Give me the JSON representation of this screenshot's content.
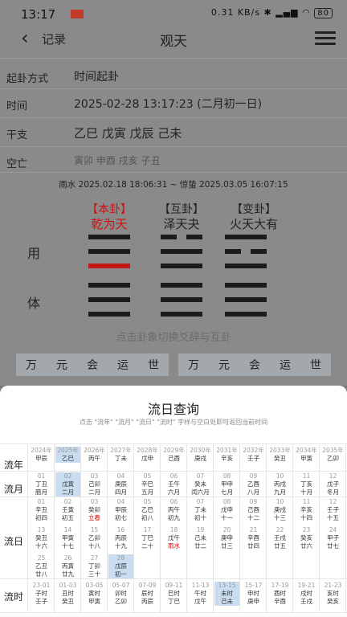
{
  "status": {
    "time": "13:17",
    "net": "0.31 KB/s",
    "battery": "80"
  },
  "nav": {
    "back_label": "记录",
    "title": "观天"
  },
  "info": [
    {
      "key": "起卦方式",
      "value": "时间起卦"
    },
    {
      "key": "时间",
      "value": "2025-02-28 13:17:23 (二月初一日)"
    },
    {
      "key": "干支",
      "value": "乙巳 戊寅 戊辰 己未"
    },
    {
      "key": "空亡",
      "value": "寅卯 申酉 戌亥 子丑"
    }
  ],
  "jieqi": "雨水 2025.02.18 18:06:31 ~ 惊蛰 2025.03.05 16:07:15",
  "gua": [
    {
      "head": "【本卦】",
      "name": "乾为天"
    },
    {
      "head": "【互卦】",
      "name": "泽天夬"
    },
    {
      "head": "【变卦】",
      "name": "火天大有"
    }
  ],
  "yong": "用",
  "ti": "体",
  "hint": "点击卦象切换爻辞与互卦",
  "tabs_left": [
    "万",
    "元",
    "会",
    "运",
    "世"
  ],
  "tabs_right": [
    "万",
    "元",
    "会",
    "运",
    "世"
  ],
  "sheet": {
    "title": "流日查询",
    "subtitle": "点击 \"流年\" \"流月\" \"流日\" \"流时\" 字样与空白处即可返回当前时间",
    "row_labels": [
      "流年",
      "流月",
      "流日",
      "流时"
    ],
    "years": [
      [
        "2024年",
        "甲辰"
      ],
      [
        "2025年",
        "乙巳"
      ],
      [
        "2026年",
        "丙午"
      ],
      [
        "2027年",
        "丁未"
      ],
      [
        "2028年",
        "戊申"
      ],
      [
        "2029年",
        "己酉"
      ],
      [
        "2030年",
        "庚戌"
      ],
      [
        "2031年",
        "辛亥"
      ],
      [
        "2032年",
        "壬子"
      ],
      [
        "2033年",
        "癸丑"
      ],
      [
        "2034年",
        "甲寅"
      ],
      [
        "2035年",
        "乙卯"
      ]
    ],
    "months": [
      [
        "01",
        "丁丑",
        "腊月"
      ],
      [
        "02",
        "戊寅",
        "二月"
      ],
      [
        "03",
        "己卯",
        "二月"
      ],
      [
        "04",
        "庚辰",
        "四月"
      ],
      [
        "05",
        "辛巳",
        "五月"
      ],
      [
        "06",
        "壬午",
        "六月"
      ],
      [
        "07",
        "癸未",
        "闰六月"
      ],
      [
        "08",
        "甲申",
        "七月"
      ],
      [
        "09",
        "乙酉",
        "八月"
      ],
      [
        "10",
        "丙戌",
        "九月"
      ],
      [
        "11",
        "丁亥",
        "十月"
      ],
      [
        "12",
        "戊子",
        "冬月"
      ]
    ],
    "days": [
      [
        "01",
        "辛丑",
        "初四"
      ],
      [
        "02",
        "壬寅",
        "初五"
      ],
      [
        "03",
        "癸卯",
        "立春"
      ],
      [
        "04",
        "甲辰",
        "初七"
      ],
      [
        "05",
        "乙巳",
        "初八"
      ],
      [
        "06",
        "丙午",
        "初九"
      ],
      [
        "07",
        "丁未",
        "初十"
      ],
      [
        "08",
        "戊申",
        "十一"
      ],
      [
        "09",
        "己酉",
        "十二"
      ],
      [
        "10",
        "庚戌",
        "十三"
      ],
      [
        "11",
        "辛亥",
        "十四"
      ],
      [
        "12",
        "壬子",
        "十五"
      ],
      [
        "13",
        "癸丑",
        "十六"
      ],
      [
        "14",
        "甲寅",
        "十七"
      ],
      [
        "15",
        "乙卯",
        "十八"
      ],
      [
        "16",
        "丙辰",
        "十九"
      ],
      [
        "17",
        "丁巳",
        "二十"
      ],
      [
        "18",
        "戊午",
        "雨水"
      ],
      [
        "19",
        "己未",
        "廿二"
      ],
      [
        "20",
        "庚申",
        "廿三"
      ],
      [
        "21",
        "辛酉",
        "廿四"
      ],
      [
        "22",
        "壬戌",
        "廿五"
      ],
      [
        "23",
        "癸亥",
        "廿六"
      ],
      [
        "24",
        "甲子",
        "廿七"
      ],
      [
        "25",
        "乙丑",
        "廿八"
      ],
      [
        "26",
        "丙寅",
        "廿九"
      ],
      [
        "27",
        "丁卯",
        "三十"
      ],
      [
        "28",
        "戊辰",
        "初一"
      ]
    ],
    "hours": [
      [
        "23-01",
        "子时",
        "壬子"
      ],
      [
        "01-03",
        "丑时",
        "癸丑"
      ],
      [
        "03-05",
        "寅时",
        "甲寅"
      ],
      [
        "05-07",
        "卯时",
        "乙卯"
      ],
      [
        "07-09",
        "辰时",
        "丙辰"
      ],
      [
        "09-11",
        "巳时",
        "丁巳"
      ],
      [
        "11-13",
        "午时",
        "戊午"
      ],
      [
        "13-15",
        "未时",
        "己未"
      ],
      [
        "15-17",
        "申时",
        "庚申"
      ],
      [
        "17-19",
        "酉时",
        "辛酉"
      ],
      [
        "19-21",
        "戌时",
        "壬戌"
      ],
      [
        "21-23",
        "亥时",
        "癸亥"
      ]
    ]
  },
  "colors": {
    "accent": "#c9dcf0",
    "red": "#d01010",
    "tab_bg": "#a3a8ad"
  }
}
